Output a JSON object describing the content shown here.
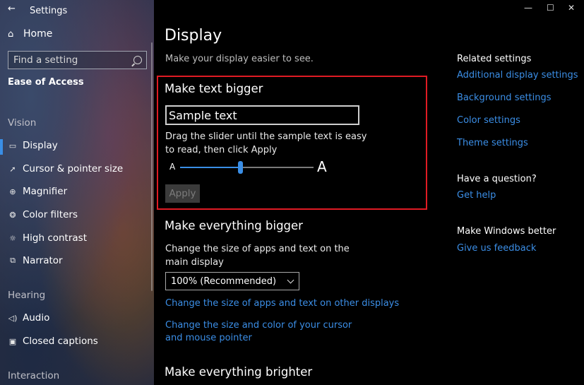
{
  "window": {
    "title": "Settings",
    "back": "←",
    "minimize": "—",
    "maximize": "☐",
    "close": "✕"
  },
  "sidebar": {
    "home": "Home",
    "search_placeholder": "Find a setting",
    "category": "Ease of Access",
    "sections": [
      {
        "header": "Vision",
        "items": [
          {
            "label": "Display",
            "icon": "monitor-icon",
            "active": true
          },
          {
            "label": "Cursor & pointer size",
            "icon": "cursor-icon"
          },
          {
            "label": "Magnifier",
            "icon": "magnifier-icon"
          },
          {
            "label": "Color filters",
            "icon": "color-filter-icon"
          },
          {
            "label": "High contrast",
            "icon": "high-contrast-icon"
          },
          {
            "label": "Narrator",
            "icon": "narrator-icon"
          }
        ]
      },
      {
        "header": "Hearing",
        "items": [
          {
            "label": "Audio",
            "icon": "speaker-icon"
          },
          {
            "label": "Closed captions",
            "icon": "captions-icon"
          }
        ]
      },
      {
        "header": "Interaction",
        "items": []
      }
    ]
  },
  "main": {
    "title": "Display",
    "subtitle": "Make your display easier to see.",
    "text_bigger": {
      "heading": "Make text bigger",
      "sample": "Sample text",
      "instruction": "Drag the slider until the sample text is easy to read, then click Apply",
      "slider_min_label": "A",
      "slider_max_label": "A",
      "slider_value": 0.45,
      "apply": "Apply"
    },
    "everything_bigger": {
      "heading": "Make everything bigger",
      "instruction": "Change the size of apps and text on the main display",
      "dropdown_value": "100% (Recommended)",
      "link_other_displays": "Change the size of apps and text on other displays",
      "link_cursor": "Change the size and color of your cursor and mouse pointer"
    },
    "everything_brighter": {
      "heading": "Make everything brighter"
    }
  },
  "related": {
    "heading": "Related settings",
    "links": [
      "Additional display settings",
      "Background settings",
      "Color settings",
      "Theme settings"
    ],
    "question_heading": "Have a question?",
    "get_help": "Get help",
    "better_heading": "Make Windows better",
    "feedback": "Give us feedback"
  },
  "colors": {
    "accent": "#3b8ee6",
    "highlight_border": "#e01b24",
    "background": "#000000"
  }
}
